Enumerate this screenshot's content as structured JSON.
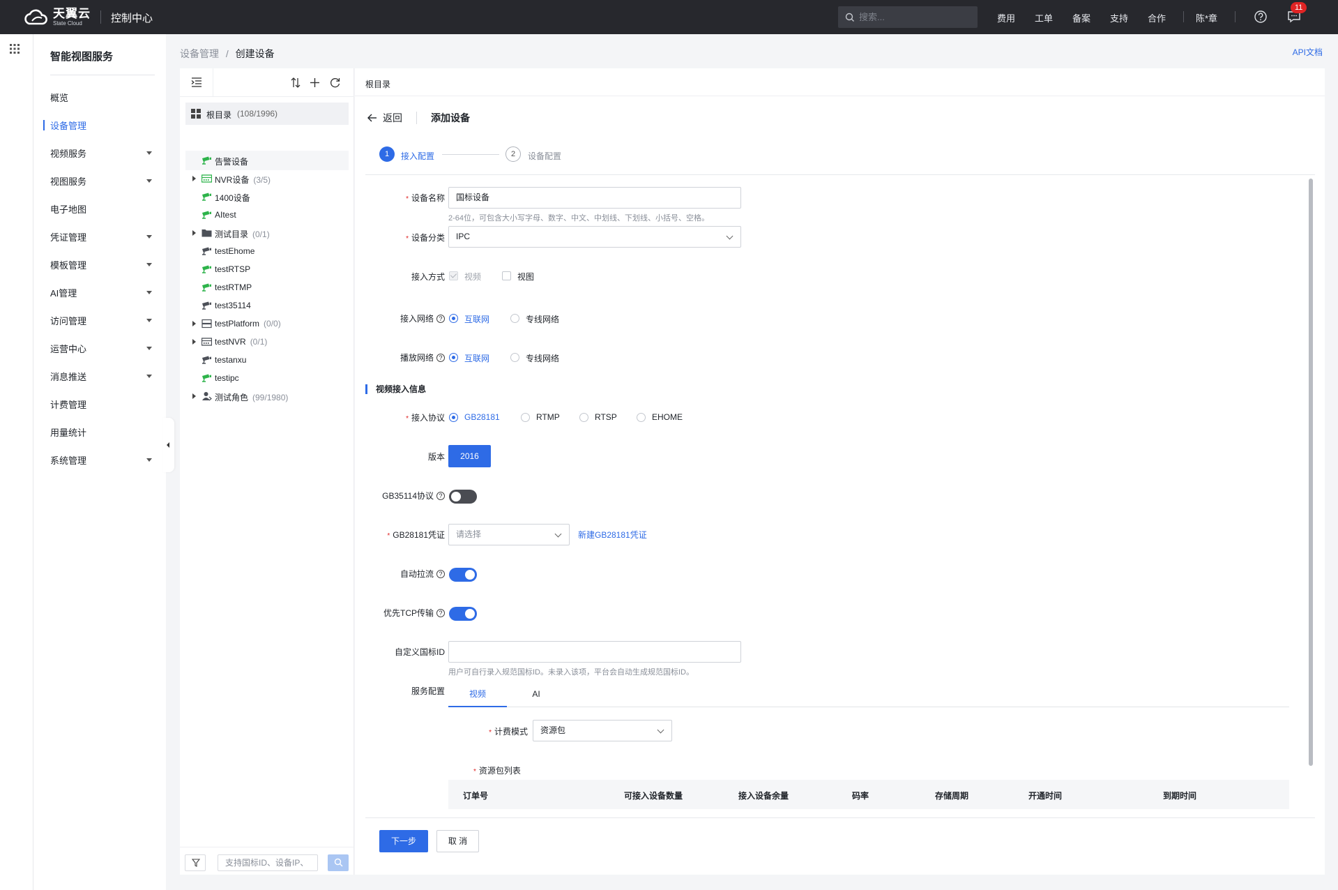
{
  "topbar": {
    "logo_cn": "天翼云",
    "logo_en": "State Cloud",
    "console": "控制中心",
    "search_placeholder": "搜索...",
    "nav": [
      "费用",
      "工单",
      "备案",
      "支持",
      "合作"
    ],
    "user": "陈*章",
    "message_count": "11"
  },
  "sidebar": {
    "title": "智能视图服务",
    "items": [
      {
        "label": "概览",
        "expandable": false
      },
      {
        "label": "设备管理",
        "expandable": false,
        "active": true
      },
      {
        "label": "视频服务",
        "expandable": true
      },
      {
        "label": "视图服务",
        "expandable": true
      },
      {
        "label": "电子地图",
        "expandable": false
      },
      {
        "label": "凭证管理",
        "expandable": true
      },
      {
        "label": "模板管理",
        "expandable": true
      },
      {
        "label": "AI管理",
        "expandable": true
      },
      {
        "label": "访问管理",
        "expandable": true
      },
      {
        "label": "运营中心",
        "expandable": true
      },
      {
        "label": "消息推送",
        "expandable": true
      },
      {
        "label": "计费管理",
        "expandable": false
      },
      {
        "label": "用量统计",
        "expandable": false
      },
      {
        "label": "系统管理",
        "expandable": true
      }
    ]
  },
  "breadcrumb": {
    "parent": "设备管理",
    "sep": "/",
    "current": "创建设备"
  },
  "api_doc": "API文档",
  "tree": {
    "root": {
      "label": "根目录",
      "count": "(108/1996)"
    },
    "nodes": [
      {
        "label": "告警设备",
        "count": "",
        "icon": "camera-green",
        "arrow": false,
        "highlight": true
      },
      {
        "label": "NVR设备",
        "count": "(3/5)",
        "icon": "nvr-green",
        "arrow": true
      },
      {
        "label": "1400设备",
        "count": "",
        "icon": "camera-green",
        "arrow": false
      },
      {
        "label": "AItest",
        "count": "",
        "icon": "camera-green",
        "arrow": false
      },
      {
        "label": "测试目录",
        "count": "(0/1)",
        "icon": "folder",
        "arrow": true
      },
      {
        "label": "testEhome",
        "count": "",
        "icon": "camera-gray",
        "arrow": false
      },
      {
        "label": "testRTSP",
        "count": "",
        "icon": "camera-green",
        "arrow": false
      },
      {
        "label": "testRTMP",
        "count": "",
        "icon": "camera-green",
        "arrow": false
      },
      {
        "label": "test35114",
        "count": "",
        "icon": "camera-gray",
        "arrow": false
      },
      {
        "label": "testPlatform",
        "count": "(0/0)",
        "icon": "platform",
        "arrow": true
      },
      {
        "label": "testNVR",
        "count": "(0/1)",
        "icon": "nvr-gray",
        "arrow": true
      },
      {
        "label": "testanxu",
        "count": "",
        "icon": "camera-gray",
        "arrow": false
      },
      {
        "label": "testipc",
        "count": "",
        "icon": "camera-green",
        "arrow": false
      },
      {
        "label": "测试角色",
        "count": "(99/1980)",
        "icon": "user-role",
        "arrow": true
      }
    ],
    "search_placeholder": "支持国标ID、设备IP、"
  },
  "main": {
    "header": "根目录",
    "back": "返回",
    "title": "添加设备",
    "steps": [
      {
        "num": "1",
        "label": "接入配置"
      },
      {
        "num": "2",
        "label": "设备配置"
      }
    ],
    "form": {
      "device_name": {
        "label": "设备名称",
        "value": "国标设备",
        "hint": "2-64位，可包含大小写字母、数字、中文、中划线、下划线、小括号、空格。"
      },
      "device_type": {
        "label": "设备分类",
        "value": "IPC"
      },
      "access_mode": {
        "label": "接入方式",
        "options": [
          "视频",
          "视图"
        ]
      },
      "access_network": {
        "label": "接入网络",
        "options": [
          "互联网",
          "专线网络"
        ]
      },
      "play_network": {
        "label": "播放网络",
        "options": [
          "互联网",
          "专线网络"
        ]
      },
      "section_video": "视频接入信息",
      "protocol": {
        "label": "接入协议",
        "options": [
          "GB28181",
          "RTMP",
          "RTSP",
          "EHOME"
        ]
      },
      "version": {
        "label": "版本",
        "value": "2016"
      },
      "gb35114": {
        "label": "GB35114协议"
      },
      "credential": {
        "label": "GB28181凭证",
        "placeholder": "请选择",
        "link": "新建GB28181凭证"
      },
      "auto_pull": {
        "label": "自动拉流"
      },
      "prefer_tcp": {
        "label": "优先TCP传输"
      },
      "custom_id": {
        "label": "自定义国标ID",
        "value": "",
        "hint": "用户可自行录入规范国标ID。未录入该项，平台会自动生成规范国标ID。"
      },
      "service": {
        "label": "服务配置",
        "tabs": [
          "视频",
          "AI"
        ]
      },
      "billing": {
        "label": "计费模式",
        "value": "资源包"
      },
      "package_list": {
        "label": "资源包列表",
        "columns": [
          "订单号",
          "可接入设备数量",
          "接入设备余量",
          "码率",
          "存储周期",
          "开通时间",
          "到期时间"
        ]
      }
    },
    "buttons": {
      "next": "下一步",
      "cancel": "取 消"
    }
  }
}
